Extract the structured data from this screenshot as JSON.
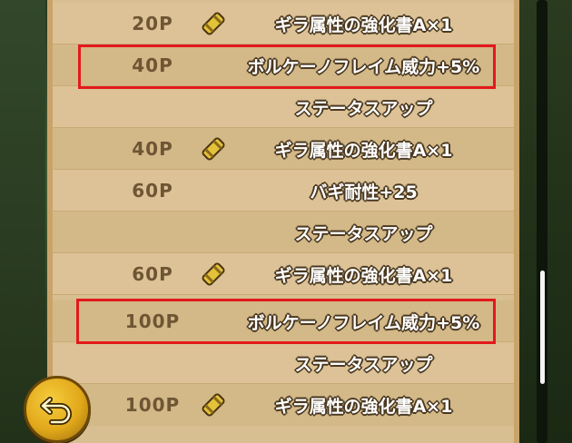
{
  "rows": [
    {
      "cost": "20P",
      "text": "ギラ属性の強化書A×1",
      "icon": "scroll-icon"
    },
    {
      "cost": "40P",
      "text": "ボルケーノフレイム威力+5%",
      "icon": ""
    },
    {
      "cost": "",
      "text": "ステータスアップ",
      "icon": ""
    },
    {
      "cost": "40P",
      "text": "ギラ属性の強化書A×1",
      "icon": "scroll-icon"
    },
    {
      "cost": "60P",
      "text": "バギ耐性+25",
      "icon": ""
    },
    {
      "cost": "",
      "text": "ステータスアップ",
      "icon": ""
    },
    {
      "cost": "60P",
      "text": "ギラ属性の強化書A×1",
      "icon": "scroll-icon"
    },
    {
      "cost": "100P",
      "text": "ボルケーノフレイム威力+5%",
      "icon": ""
    },
    {
      "cost": "",
      "text": "ステータスアップ",
      "icon": ""
    },
    {
      "cost": "100P",
      "text": "ギラ属性の強化書A×1",
      "icon": "scroll-icon"
    }
  ],
  "colors": {
    "highlight": "#e2191c",
    "cost_text": "#6e5634",
    "panel": "#d8bf91",
    "scroll_gold": "#e3c23a"
  },
  "back_button": {
    "icon": "back-arrow-icon"
  }
}
